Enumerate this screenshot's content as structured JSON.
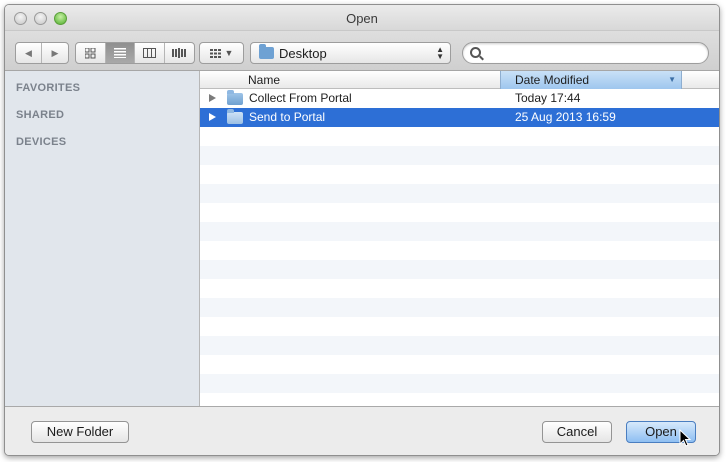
{
  "window": {
    "title": "Open"
  },
  "toolbar": {
    "back_icon": "back-arrow-icon",
    "forward_icon": "forward-arrow-icon",
    "views": [
      "icon-view",
      "list-view",
      "column-view",
      "cover-flow-view"
    ],
    "active_view": "list-view",
    "location": "Desktop",
    "search_value": ""
  },
  "sidebar": {
    "sections": [
      {
        "label": "FAVORITES"
      },
      {
        "label": "SHARED"
      },
      {
        "label": "DEVICES"
      }
    ]
  },
  "columns": {
    "name": "Name",
    "date": "Date Modified"
  },
  "files": [
    {
      "name": "Collect From Portal",
      "date": "Today 17:44",
      "selected": false
    },
    {
      "name": "Send to Portal",
      "date": "25 Aug 2013 16:59",
      "selected": true
    }
  ],
  "buttons": {
    "new_folder": "New Folder",
    "cancel": "Cancel",
    "open": "Open"
  },
  "colors": {
    "selection": "#2d6fd6",
    "sidebar": "#e1e6ec",
    "sorted_column": "#9ec6ee"
  }
}
